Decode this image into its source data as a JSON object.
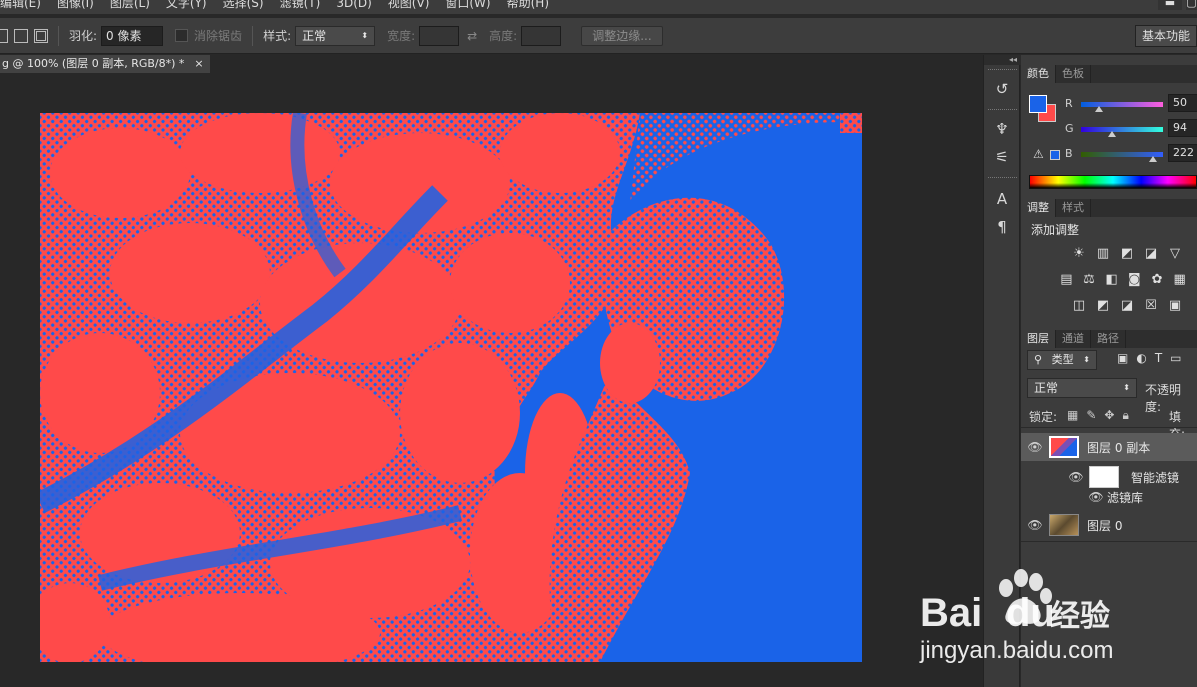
{
  "menu": [
    "编辑(E)",
    "图像(I)",
    "图层(L)",
    "文字(Y)",
    "选择(S)",
    "滤镜(T)",
    "3D(D)",
    "视图(V)",
    "窗口(W)",
    "帮助(H)"
  ],
  "window_controls": {
    "minimize": "▬",
    "restore": "▢"
  },
  "options": {
    "feather_label": "羽化:",
    "feather_value": "0 像素",
    "antialias_label": "消除锯齿",
    "style_label": "样式:",
    "style_value": "正常",
    "width_label": "宽度:",
    "height_label": "高度:",
    "refine_edge": "调整边缘...",
    "workspace": "基本功能"
  },
  "document_tab": {
    "title": "g @ 100% (图层 0 副本, RGB/8*) *",
    "close": "×"
  },
  "color_panel": {
    "tabs": [
      "颜色",
      "色板"
    ],
    "r_label": "R",
    "r_value": "50",
    "g_label": "G",
    "g_value": "94",
    "b_label": "B",
    "b_value": "222",
    "fg_color": "#1a63e8",
    "bg_color": "#ff4a4a"
  },
  "adjustments_panel": {
    "tabs": [
      "调整",
      "样式"
    ],
    "title": "添加调整",
    "row1": [
      "☀",
      "▥",
      "◩",
      "◪",
      "▽"
    ],
    "row2": [
      "▤",
      "⚖",
      "◧",
      "◙",
      "✿",
      "▦"
    ],
    "row3": [
      "◫",
      "◩",
      "◪",
      "☒",
      "▣"
    ]
  },
  "layers_panel": {
    "tabs": [
      "图层",
      "通道",
      "路径"
    ],
    "filter_type": "类型",
    "blend_mode": "正常",
    "opacity_label": "不透明度:",
    "lock_label": "锁定:",
    "fill_label": "填充:",
    "layers": [
      {
        "name": "图层 0 副本"
      },
      {
        "name": "智能滤镜"
      },
      {
        "name": "滤镜库"
      },
      {
        "name": "图层 0"
      }
    ]
  },
  "watermark": {
    "brand_a": "Bai",
    "brand_b": "du",
    "brand_c": "经验",
    "url": "jingyan.baidu.com"
  }
}
